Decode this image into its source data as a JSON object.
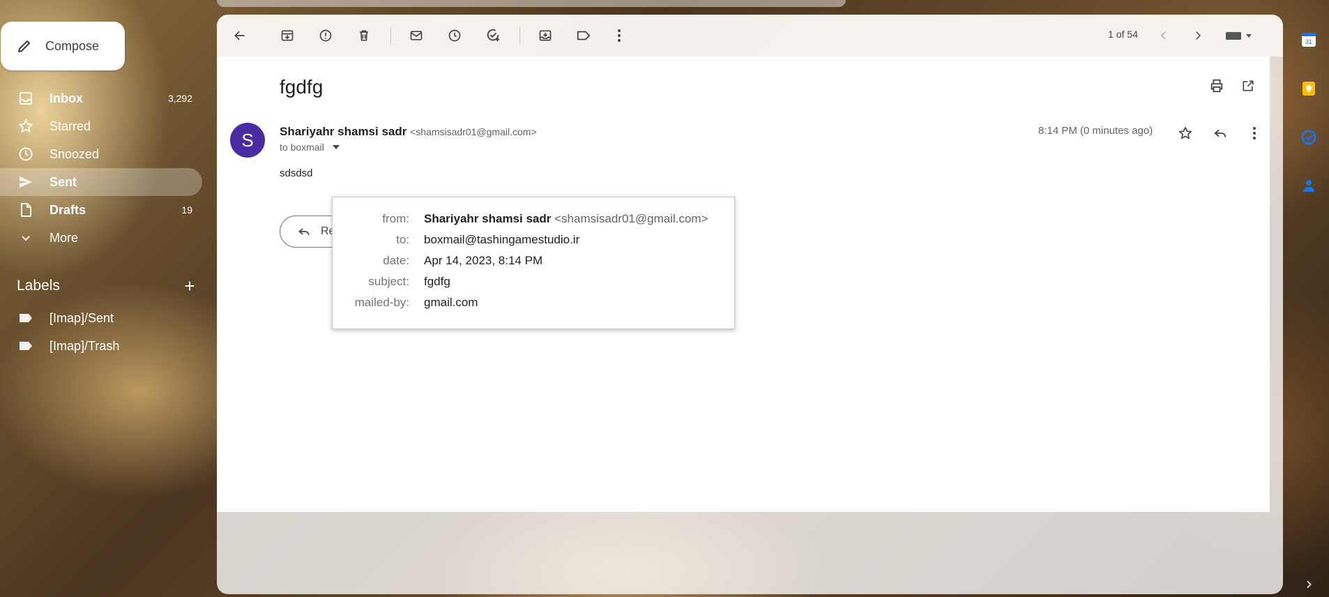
{
  "compose": {
    "label": "Compose",
    "icon": "pencil-icon"
  },
  "nav": {
    "items": [
      {
        "label": "Inbox",
        "count": "3,292",
        "icon": "inbox-icon"
      },
      {
        "label": "Starred",
        "count": "",
        "icon": "star-icon"
      },
      {
        "label": "Snoozed",
        "count": "",
        "icon": "clock-icon"
      },
      {
        "label": "Sent",
        "count": "",
        "icon": "send-icon"
      },
      {
        "label": "Drafts",
        "count": "19",
        "icon": "draft-icon"
      },
      {
        "label": "More",
        "count": "",
        "icon": "chevron-down-icon"
      }
    ]
  },
  "labels": {
    "heading": "Labels",
    "add": "+",
    "items": [
      {
        "label": "[Imap]/Sent",
        "icon": "label-icon"
      },
      {
        "label": "[Imap]/Trash",
        "icon": "label-icon"
      }
    ]
  },
  "toolbar": {
    "pager": "1 of 54",
    "icons": [
      "back-arrow-icon",
      "archive-icon",
      "report-spam-icon",
      "delete-icon",
      "mark-unread-icon",
      "snooze-icon",
      "add-task-icon",
      "move-to-icon",
      "label-icon",
      "more-vert-icon",
      "chevron-left-icon",
      "chevron-right-icon",
      "keyboard-icon"
    ]
  },
  "message": {
    "subject": "fgdfg",
    "avatar_letter": "S",
    "avatar_color": "#4b2ba3",
    "sender_name": "Shariyahr shamsi sadr",
    "sender_email": "<shamsisadr01@gmail.com>",
    "to_line": "to boxmail",
    "time": "8:14 PM (0 minutes ago)",
    "body": "sdsdsd",
    "reply_label": "Reply"
  },
  "details": {
    "rows": [
      {
        "key": "from:",
        "value_name": "Shariyahr shamsi sadr",
        "value_extra": "<shamsisadr01@gmail.com>"
      },
      {
        "key": "to:",
        "value_name": "boxmail@tashingamestudio.ir",
        "value_extra": ""
      },
      {
        "key": "date:",
        "value_name": "Apr 14, 2023, 8:14 PM",
        "value_extra": ""
      },
      {
        "key": "subject:",
        "value_name": "fgdfg",
        "value_extra": ""
      },
      {
        "key": "mailed-by:",
        "value_name": "gmail.com",
        "value_extra": ""
      }
    ]
  },
  "side_rail": {
    "icons": [
      "calendar-icon",
      "keep-icon",
      "tasks-icon",
      "contacts-icon",
      "expand-panel-icon"
    ],
    "calendar_day": "31"
  }
}
